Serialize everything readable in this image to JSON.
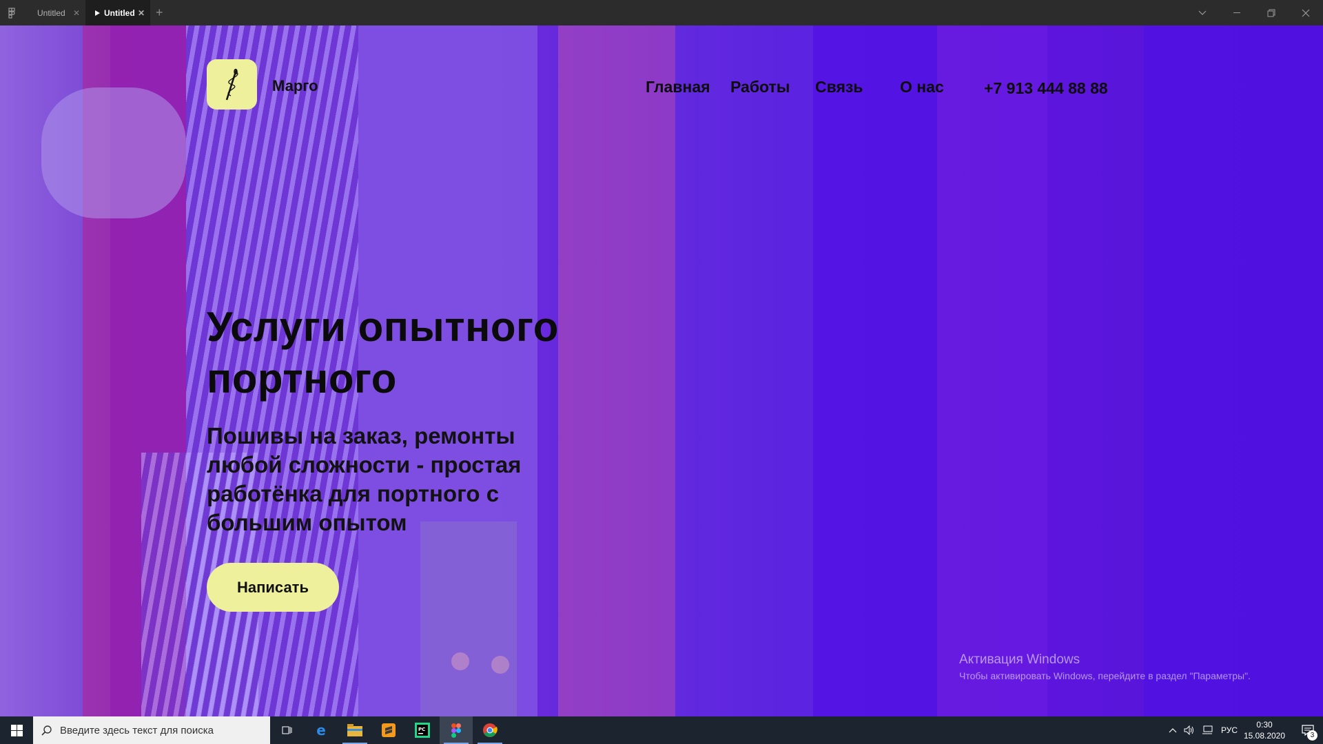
{
  "window": {
    "tabs": [
      {
        "label": "Untitled",
        "active": false
      },
      {
        "label": "Untitled",
        "active": true
      }
    ]
  },
  "site": {
    "brand": "Марго",
    "nav": [
      "Главная",
      "Работы",
      "Связь",
      "О нас"
    ],
    "phone": "+7 913 444 88 88",
    "hero_title_line1": "Услуги опытного",
    "hero_title_line2": "портного",
    "hero_subtitle": "Пошивы на заказ, ремонты любой сложности - простая работёнка для портного с большим опытом",
    "cta_label": "Написать",
    "colors": {
      "accent": "#eef09c",
      "overlay": "#5010e0"
    }
  },
  "watermark": {
    "title": "Активация Windows",
    "text": "Чтобы активировать Windows, перейдите в раздел \"Параметры\"."
  },
  "taskbar": {
    "search_placeholder": "Введите здесь текст для поиска",
    "apps": [
      "task-view-icon",
      "edge-icon",
      "file-explorer-icon",
      "sublime-text-icon",
      "pycharm-icon",
      "figma-icon",
      "chrome-icon"
    ],
    "language": "РУС",
    "time": "0:30",
    "date": "15.08.2020",
    "notifications": "3"
  }
}
